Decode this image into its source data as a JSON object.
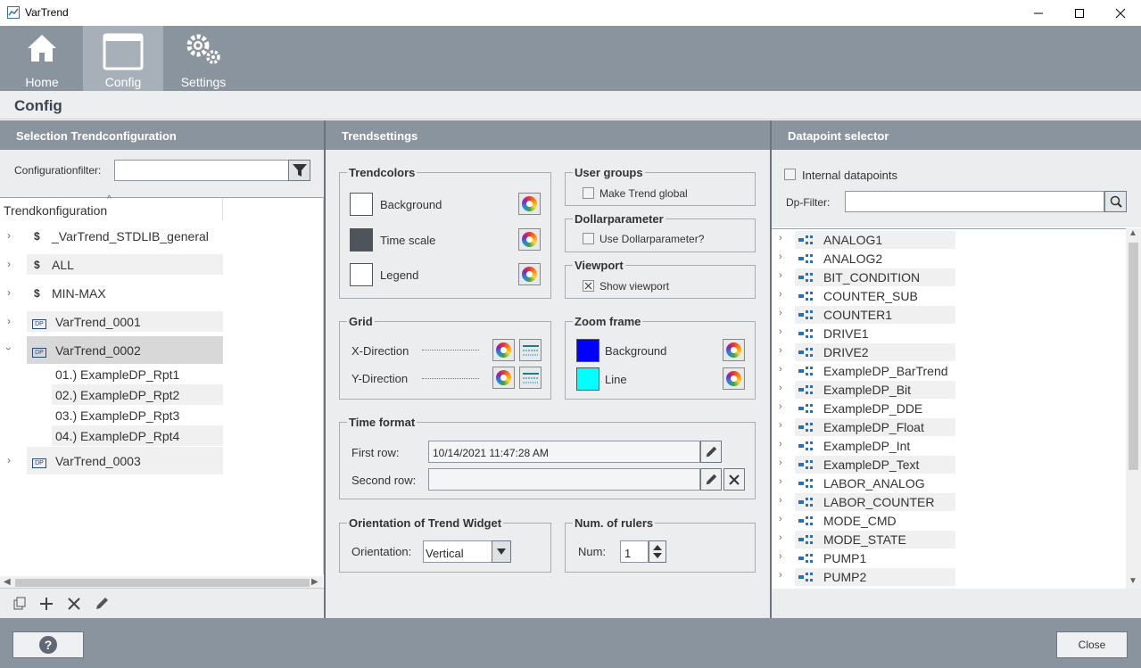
{
  "window": {
    "title": "VarTrend"
  },
  "toolbar": {
    "home": "Home",
    "config": "Config",
    "settings": "Settings"
  },
  "breadcrumb": "Config",
  "left_panel": {
    "title": "Selection Trendconfiguration",
    "filter_label": "Configurationfilter:",
    "filter_value": "",
    "column_header": "Trendkonfiguration",
    "items": [
      {
        "icon": "$",
        "label": "_VarTrend_STDLIB_general"
      },
      {
        "icon": "$",
        "label": "ALL"
      },
      {
        "icon": "$",
        "label": "MIN-MAX"
      },
      {
        "icon": "DP",
        "label": "VarTrend_0001"
      },
      {
        "icon": "DP",
        "label": "VarTrend_0002"
      },
      {
        "icon": "DP",
        "label": "VarTrend_0003"
      }
    ],
    "children": [
      "01.) ExampleDP_Rpt1",
      "02.) ExampleDP_Rpt2",
      "03.) ExampleDP_Rpt3",
      "04.) ExampleDP_Rpt4"
    ]
  },
  "mid_panel": {
    "title": "Trendsettings",
    "trendcolors": {
      "title": "Trendcolors",
      "background": "Background",
      "timescale": "Time scale",
      "legend": "Legend",
      "colors": {
        "background": "#ffffff",
        "timescale": "#4d545c",
        "legend": "#ffffff"
      }
    },
    "usergroups": {
      "title": "User groups",
      "make_global": "Make Trend global"
    },
    "dollar": {
      "title": "Dollarparameter",
      "use": "Use Dollarparameter?"
    },
    "viewport": {
      "title": "Viewport",
      "show": "Show viewport"
    },
    "grid": {
      "title": "Grid",
      "x": "X-Direction",
      "y": "Y-Direction"
    },
    "zoom": {
      "title": "Zoom frame",
      "background": "Background",
      "line": "Line",
      "colors": {
        "background": "#0000ff",
        "line": "#00ffff"
      }
    },
    "timeformat": {
      "title": "Time format",
      "first_row": "First row:",
      "first_value": "10/14/2021 11:47:28 AM",
      "second_row": "Second row:",
      "second_value": ""
    },
    "orientation": {
      "title": "Orientation of Trend Widget",
      "label": "Orientation:",
      "value": "Vertical"
    },
    "rulers": {
      "title": "Num. of rulers",
      "label": "Num:",
      "value": "1"
    }
  },
  "right_panel": {
    "title": "Datapoint selector",
    "internal": "Internal datapoints",
    "filter_label": "Dp-Filter:",
    "filter_value": "",
    "items": [
      "ANALOG1",
      "ANALOG2",
      "BIT_CONDITION",
      "COUNTER_SUB",
      "COUNTER1",
      "DRIVE1",
      "DRIVE2",
      "ExampleDP_BarTrend",
      "ExampleDP_Bit",
      "ExampleDP_DDE",
      "ExampleDP_Float",
      "ExampleDP_Int",
      "ExampleDP_Text",
      "LABOR_ANALOG",
      "LABOR_COUNTER",
      "MODE_CMD",
      "MODE_STATE",
      "PUMP1",
      "PUMP2"
    ]
  },
  "bottom": {
    "help": "?",
    "close": "Close"
  }
}
